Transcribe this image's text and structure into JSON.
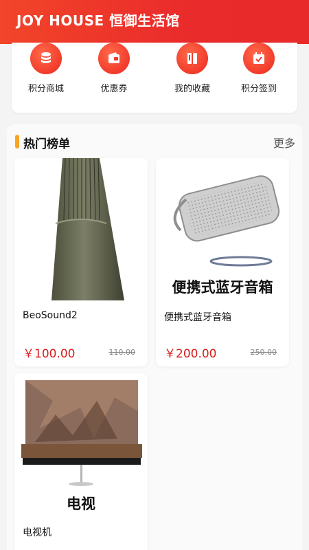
{
  "header": {
    "title": "JOY HOUSE 恒御生活馆"
  },
  "quick_links": [
    {
      "label": "积分商城",
      "icon": "coin-stack-icon"
    },
    {
      "label": "优惠券",
      "icon": "wallet-icon"
    },
    {
      "label": "我的收藏",
      "icon": "book-bookmark-icon"
    },
    {
      "label": "积分签到",
      "icon": "calendar-check-icon"
    }
  ],
  "hot": {
    "title": "热门榜单",
    "more": "更多"
  },
  "products": [
    {
      "name": "BeoSound2",
      "price": "￥100.00",
      "old_price": "110.00"
    },
    {
      "name": "便携式蓝牙音箱",
      "image_caption": "便携式蓝牙音箱",
      "price": "￥200.00",
      "old_price": "250.00"
    },
    {
      "name": "电视机",
      "image_caption": "电视"
    }
  ],
  "colors": {
    "brand_red": "#ea2b2b",
    "price_red": "#d81e1e",
    "accent_orange": "#f5a623"
  }
}
